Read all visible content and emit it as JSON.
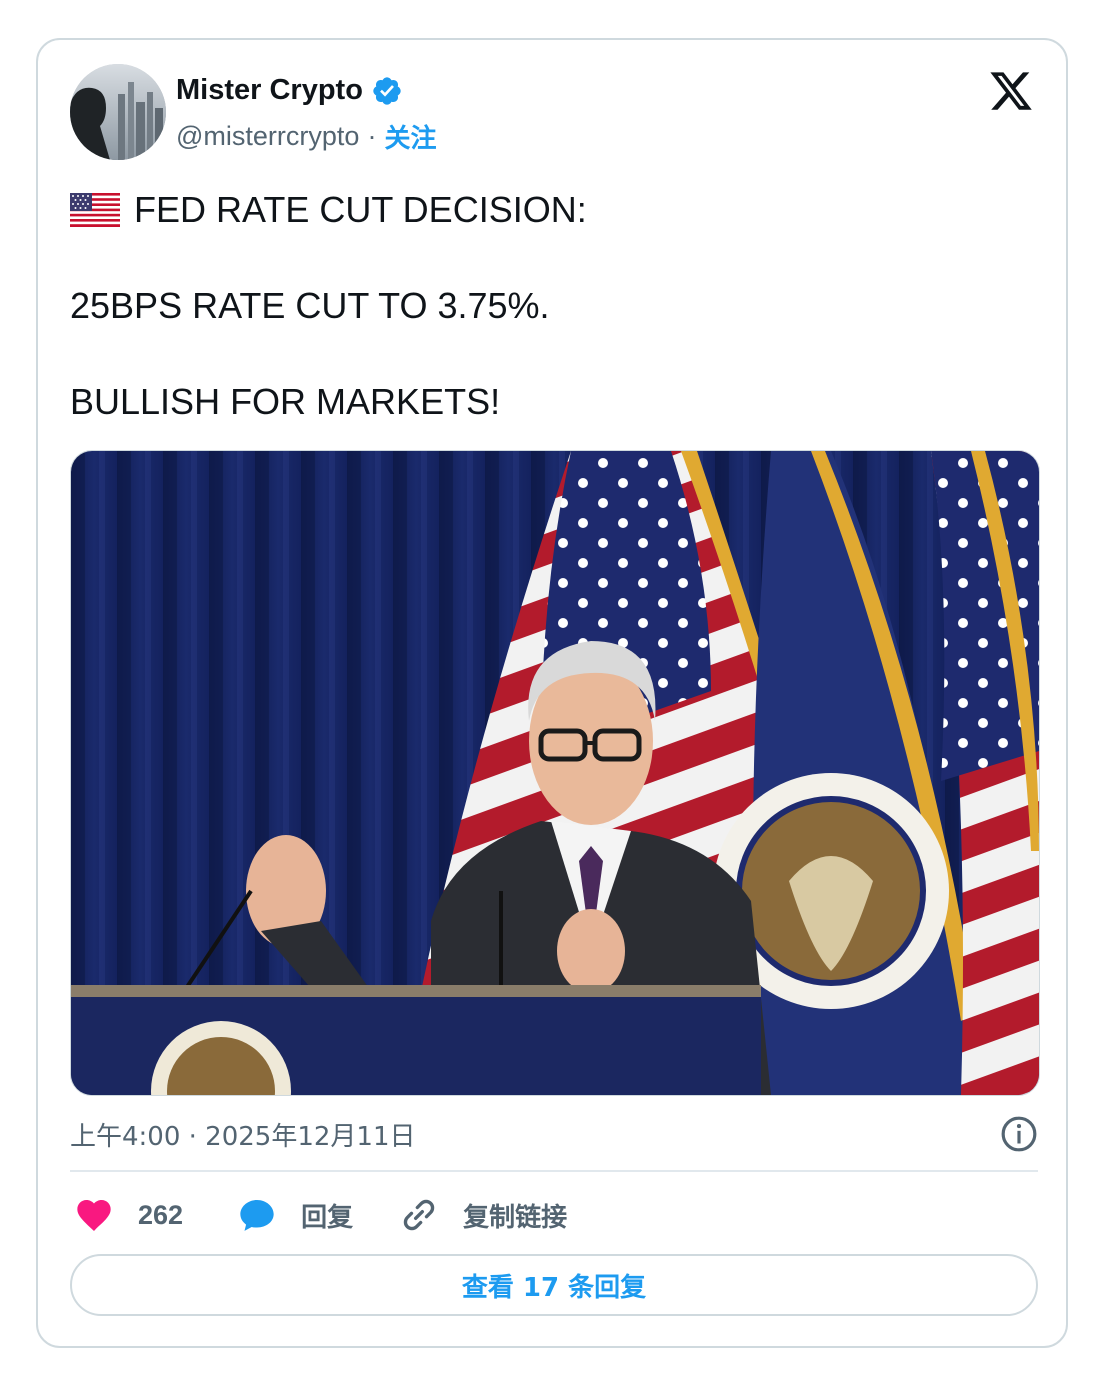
{
  "author": {
    "display_name": "Mister Crypto",
    "handle": "@misterrcrypto",
    "separator": "·",
    "follow_label": "关注",
    "verified": true
  },
  "brand": {
    "logo_icon": "x-logo-icon"
  },
  "tweet": {
    "flag_emoji": "us-flag-emoji",
    "line1": "FED RATE CUT DECISION:",
    "line2": "25BPS RATE CUT TO 3.75%.",
    "line3": "BULLISH FOR MARKETS!"
  },
  "meta": {
    "timestamp": "上午4:00 · 2025年12月11日",
    "info_icon": "info-icon"
  },
  "actions": {
    "like_count": "262",
    "reply_label": "回复",
    "copy_link_label": "复制链接"
  },
  "footer": {
    "view_replies_label": "查看 17 条回复"
  },
  "colors": {
    "accent": "#1d9bf0",
    "like": "#f91880",
    "text_primary": "#0f1419",
    "text_secondary": "#536471",
    "border": "#cfd9de"
  }
}
